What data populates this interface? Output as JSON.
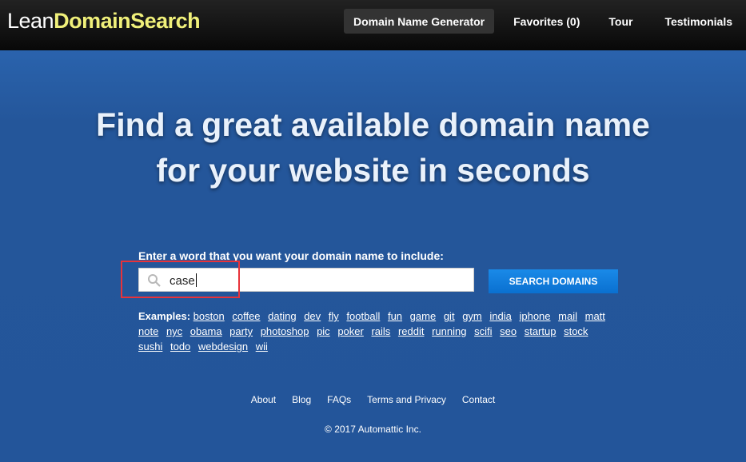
{
  "header": {
    "logo_light": "Lean",
    "logo_bold": "DomainSearch",
    "nav": [
      {
        "label": "Domain Name Generator",
        "active": true
      },
      {
        "label": "Favorites (0)"
      },
      {
        "label": "Tour"
      },
      {
        "label": "Testimonials"
      }
    ]
  },
  "hero": {
    "line1": "Find a great available domain name",
    "line2": "for your website in seconds"
  },
  "search": {
    "label": "Enter a word that you want your domain name to include:",
    "value": "case",
    "icon": "search-icon",
    "button": "SEARCH DOMAINS"
  },
  "examples": {
    "label": "Examples:",
    "items": [
      "boston",
      "coffee",
      "dating",
      "dev",
      "fly",
      "football",
      "fun",
      "game",
      "git",
      "gym",
      "india",
      "iphone",
      "mail",
      "matt",
      "note",
      "nyc",
      "obama",
      "party",
      "photoshop",
      "pic",
      "poker",
      "rails",
      "reddit",
      "running",
      "scifi",
      "seo",
      "startup",
      "stock",
      "sushi",
      "todo",
      "webdesign",
      "wii"
    ]
  },
  "footer": {
    "links": [
      "About",
      "Blog",
      "FAQs",
      "Terms and Privacy",
      "Contact"
    ],
    "copyright": "© 2017 Automattic Inc."
  },
  "colors": {
    "background": "#23559a",
    "logo_accent": "#f0f07a",
    "button": "#0a7ad8",
    "highlight_box": "#e8333a"
  }
}
